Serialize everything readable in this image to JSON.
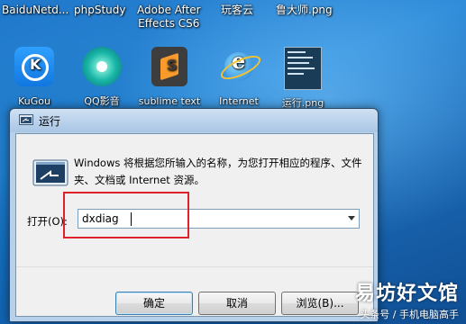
{
  "desktop": {
    "top_labels": [
      {
        "line1": "BaiduNetd...",
        "line2": ""
      },
      {
        "line1": "phpStudy",
        "line2": ""
      },
      {
        "line1": "Adobe After",
        "line2": "Effects CS6"
      },
      {
        "line1": "玩客云",
        "line2": ""
      },
      {
        "line1": "鲁大师.png",
        "line2": ""
      }
    ],
    "icons": [
      {
        "label": "KuGou"
      },
      {
        "label": "QQ影音"
      },
      {
        "label": "sublime text"
      },
      {
        "label": "Internet"
      },
      {
        "label": "运行.png"
      }
    ]
  },
  "run_dialog": {
    "title": "运行",
    "description": "Windows 将根据您所输入的名称，为您打开相应的程序、文件夹、文档或 Internet 资源。",
    "open_label": "打开(O):",
    "input_value": "dxdiag",
    "buttons": {
      "ok": "确定",
      "cancel": "取消",
      "browse": "浏览(B)..."
    }
  },
  "watermark": {
    "main": "易坊好文馆",
    "sub": "头条号 / 手机电脑高手"
  }
}
